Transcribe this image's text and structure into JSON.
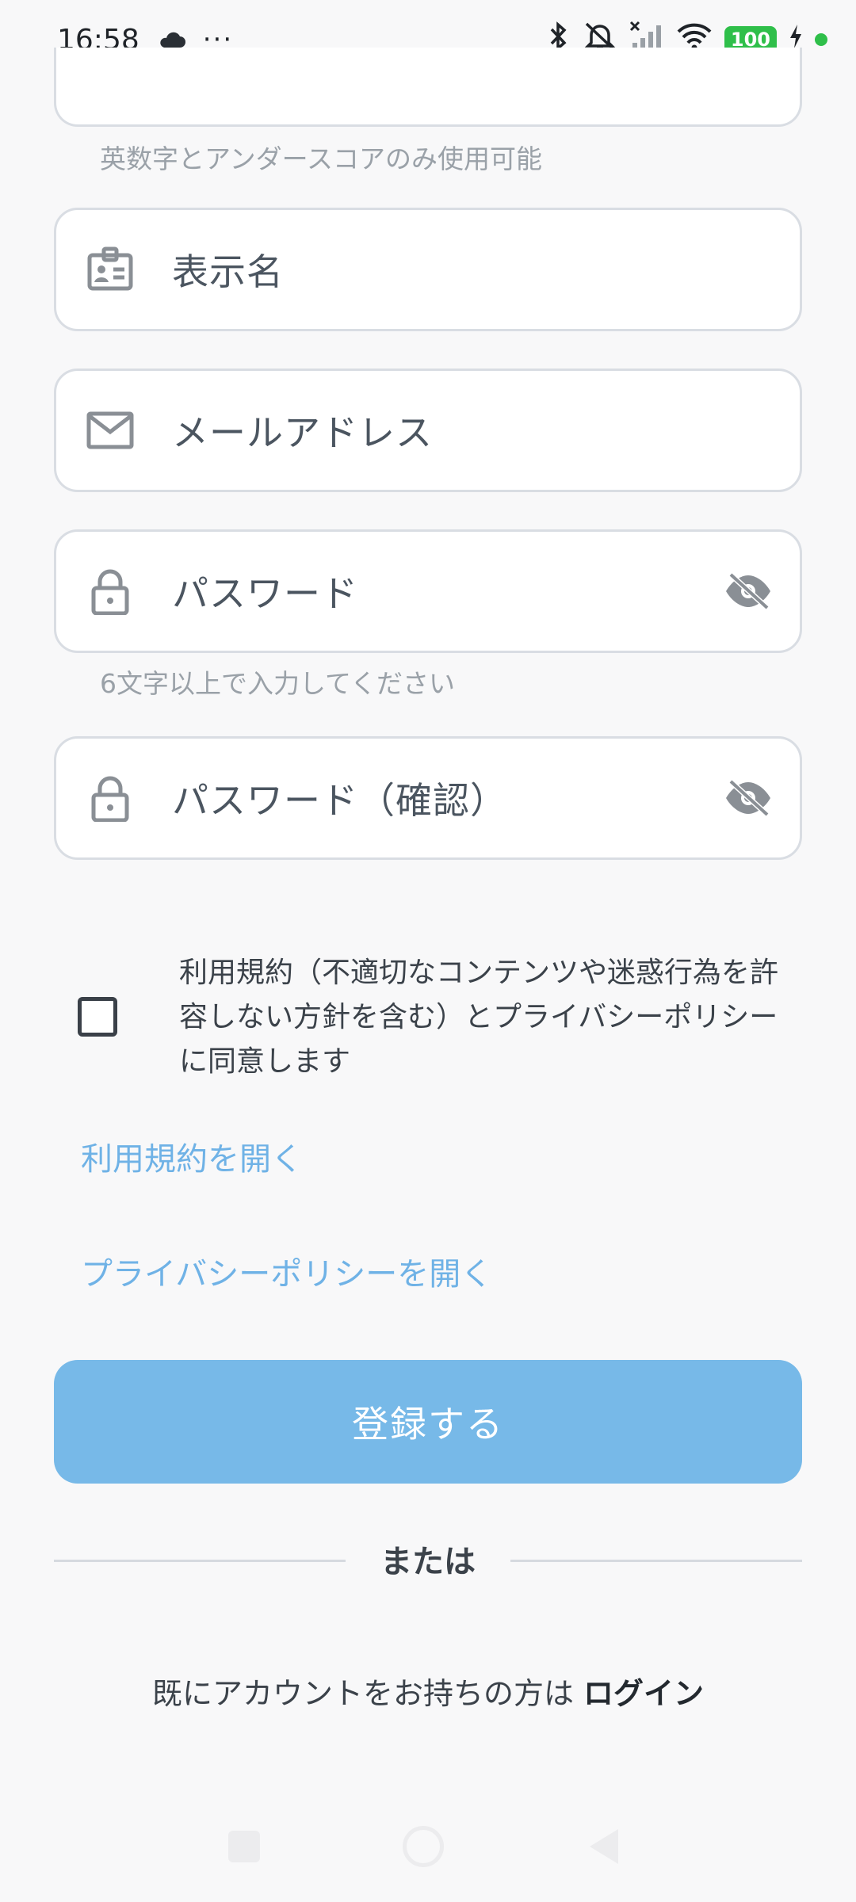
{
  "status": {
    "time": "16:58",
    "battery": "100"
  },
  "form": {
    "username_hint": "英数字とアンダースコアのみ使用可能",
    "display_name": {
      "placeholder": "表示名"
    },
    "email": {
      "placeholder": "メールアドレス"
    },
    "password": {
      "placeholder": "パスワード",
      "hint": "6文字以上で入力してください"
    },
    "password_confirm": {
      "placeholder": "パスワード（確認）"
    },
    "agree_text": "利用規約（不適切なコンテンツや迷惑行為を許容しない方針を含む）とプライバシーポリシーに同意します",
    "agree_checked": false,
    "open_terms": "利用規約を開く",
    "open_privacy": "プライバシーポリシーを開く",
    "register_button": "登録する",
    "or_divider": "または",
    "have_account": "既にアカウントをお持ちの方は",
    "login_link": "ログイン"
  },
  "colors": {
    "accent": "#77b9e8",
    "link": "#6fb2e6",
    "battery": "#2fbf4a"
  },
  "icons": [
    "cloud-icon",
    "more-icon",
    "bluetooth-icon",
    "mute-icon",
    "signal-icon",
    "wifi-icon",
    "charging-icon",
    "id-card-icon",
    "mail-icon",
    "lock-icon",
    "eye-off-icon"
  ]
}
